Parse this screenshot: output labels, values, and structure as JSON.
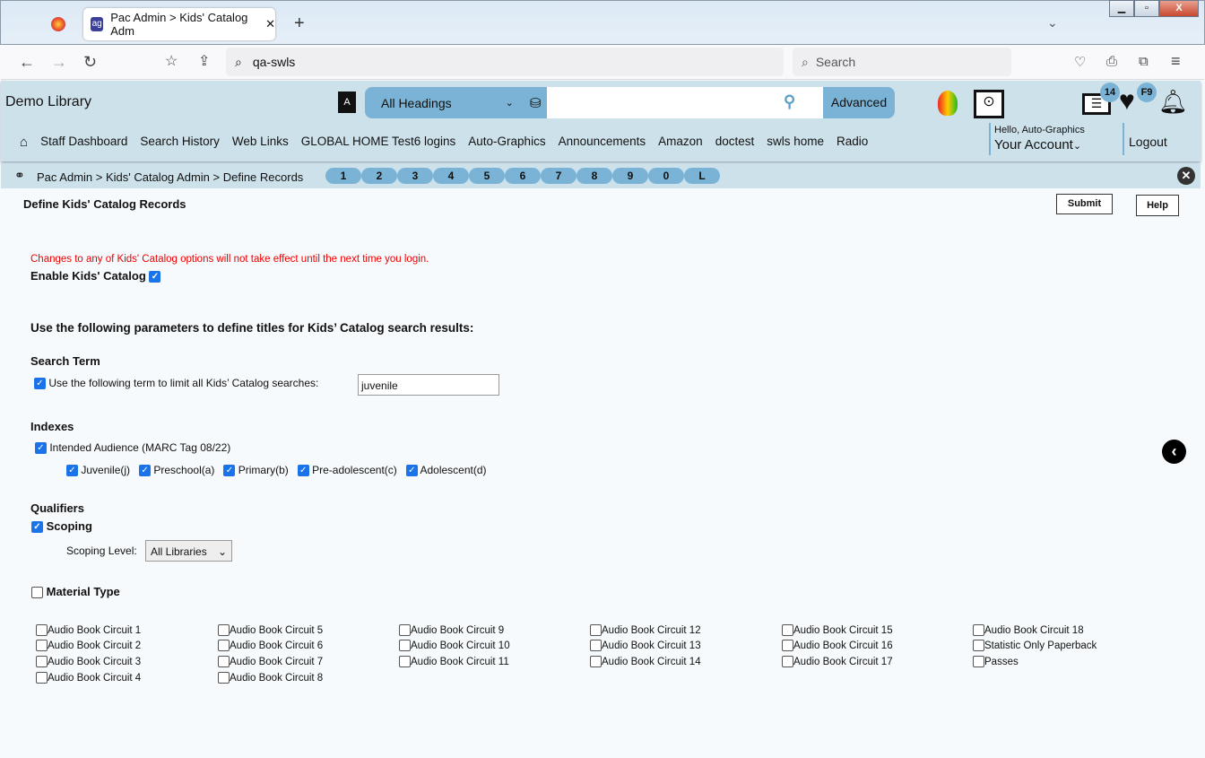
{
  "browser": {
    "tab_title": "Pac Admin > Kids' Catalog Adm",
    "url": "qa-swls",
    "search_placeholder": "Search"
  },
  "header": {
    "library": "Demo Library",
    "heading_select": "All Headings",
    "advanced": "Advanced",
    "list_count": "14",
    "fav_badge": "F9",
    "hello": "Hello, Auto-Graphics",
    "account": "Your Account",
    "logout": "Logout"
  },
  "menu": [
    "Staff Dashboard",
    "Search History",
    "Web Links",
    "GLOBAL HOME Test6 logins",
    "Auto-Graphics",
    "Announcements",
    "Amazon",
    "doctest",
    "swls home",
    "Radio"
  ],
  "breadcrumb": "Pac Admin > Kids' Catalog Admin > Define Records",
  "pills": [
    "1",
    "2",
    "3",
    "4",
    "5",
    "6",
    "7",
    "8",
    "9",
    "0",
    "L"
  ],
  "page": {
    "title": "Define Kids' Catalog Records",
    "submit": "Submit",
    "help": "Help",
    "warning": "Changes to any of Kids' Catalog options will not take effect until the next time you login.",
    "enable": "Enable Kids' Catalog",
    "params": "Use the following parameters to define titles for Kids’ Catalog search results:",
    "search_term": "Search Term",
    "limit_label": "Use the following term to limit all Kids’ Catalog searches:",
    "limit_value": "juvenile",
    "indexes": "Indexes",
    "audience": "Intended Audience (MARC Tag 08/22)",
    "audience_opts": [
      "Juvenile(j)",
      "Preschool(a)",
      "Primary(b)",
      "Pre-adolescent(c)",
      "Adolescent(d)"
    ],
    "qualifiers": "Qualifiers",
    "scoping": "Scoping",
    "scoping_level_label": "Scoping Level:",
    "scoping_level": "All Libraries",
    "material_type": "Material Type",
    "materials": [
      [
        "Audio Book Circuit 1",
        "Audio Book Circuit 2",
        "Audio Book Circuit 3",
        "Audio Book Circuit 4"
      ],
      [
        "Audio Book Circuit 5",
        "Audio Book Circuit 6",
        "Audio Book Circuit 7",
        "Audio Book Circuit 8"
      ],
      [
        "Audio Book Circuit 9",
        "Audio Book Circuit 10",
        "Audio Book Circuit 11"
      ],
      [
        "Audio Book Circuit 12",
        "Audio Book Circuit 13",
        "Audio Book Circuit 14"
      ],
      [
        "Audio Book Circuit 15",
        "Audio Book Circuit 16",
        "Audio Book Circuit 17"
      ],
      [
        "Audio Book Circuit 18",
        "Statistic Only Paperback",
        "Passes"
      ]
    ]
  }
}
